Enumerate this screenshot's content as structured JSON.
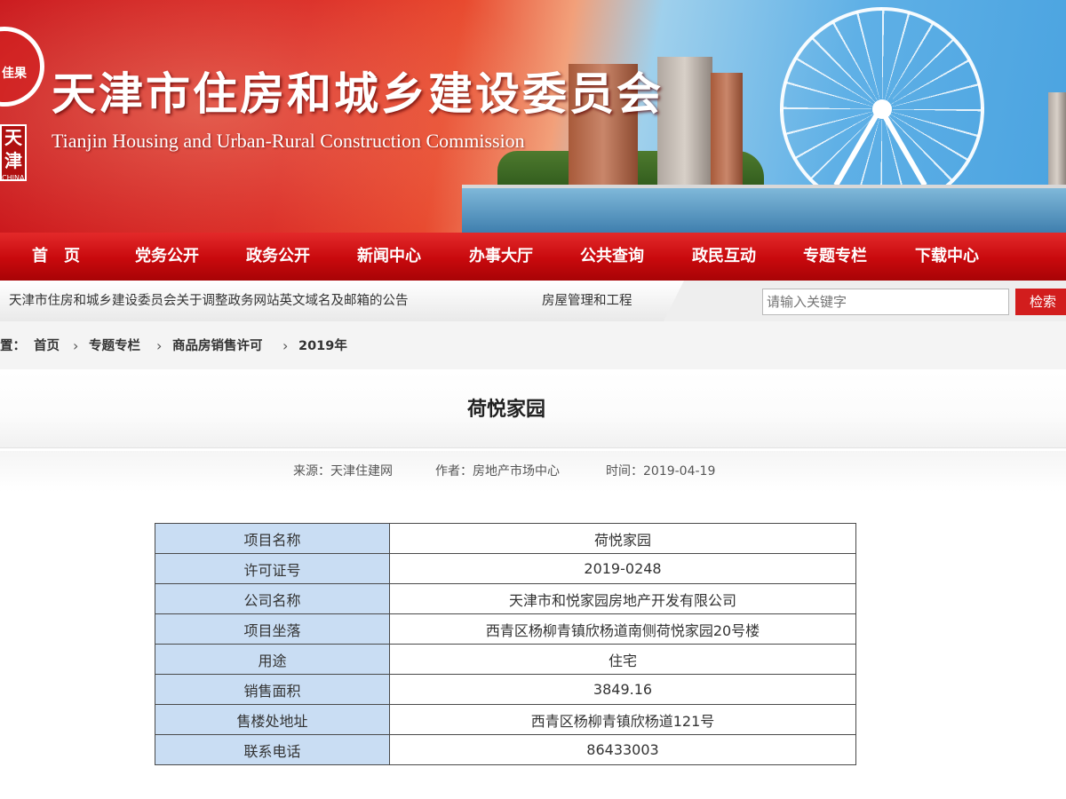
{
  "header": {
    "title": "天津市住房和城乡建设委员会",
    "subtitle": "Tianjin Housing and Urban-Rural Construction Commission",
    "logo_text": "佳果",
    "stamp_text": "天津",
    "stamp_sub": "CHINA"
  },
  "nav": {
    "items": [
      "首　页",
      "党务公开",
      "政务公开",
      "新闻中心",
      "办事大厅",
      "公共查询",
      "政民互动",
      "专题专栏",
      "下载中心"
    ]
  },
  "notice": {
    "text": "天津市住房和城乡建设委员会关于调整政务网站英文域名及邮箱的公告",
    "link": "房屋管理和工程"
  },
  "search": {
    "placeholder": "请输入关键字",
    "button_label": "检索"
  },
  "breadcrumb": {
    "prefix": "置：",
    "items": [
      "首页",
      "专题专栏",
      "商品房销售许可",
      "2019年"
    ]
  },
  "article": {
    "title": "荷悦家园",
    "meta": {
      "source": "来源：天津住建网",
      "author": "作者：房地产市场中心",
      "time": "时间：2019-04-19"
    }
  },
  "info_table": {
    "rows": [
      {
        "label": "项目名称",
        "value": "荷悦家园"
      },
      {
        "label": "许可证号",
        "value": "2019-0248"
      },
      {
        "label": "公司名称",
        "value": "天津市和悦家园房地产开发有限公司"
      },
      {
        "label": "项目坐落",
        "value": "西青区杨柳青镇欣杨道南侧荷悦家园20号楼"
      },
      {
        "label": "用途",
        "value": "住宅"
      },
      {
        "label": "销售面积",
        "value": "3849.16"
      },
      {
        "label": "售楼处地址",
        "value": "西青区杨柳青镇欣杨道121号"
      },
      {
        "label": "联系电话",
        "value": "86433003"
      }
    ]
  },
  "colors": {
    "banner_red": "#c9141a",
    "nav_red": "#c8090d",
    "table_label_bg": "#c9ddf3",
    "search_button": "#d21d1d"
  }
}
